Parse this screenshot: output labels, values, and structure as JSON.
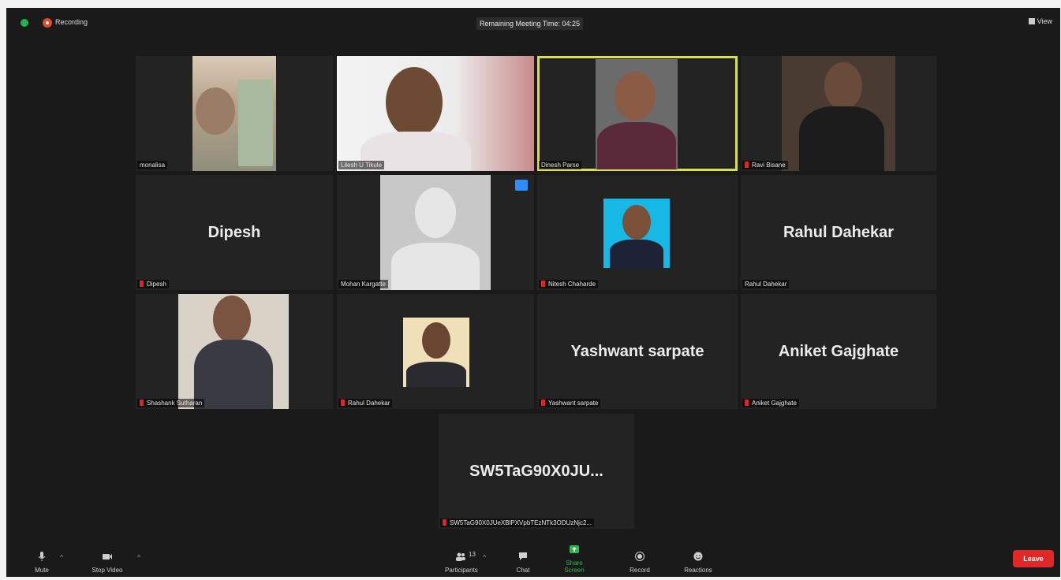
{
  "topbar": {
    "recording_label": "Recording",
    "remaining_time": "Remaining Meeting Time: 04:25",
    "view_label": "View"
  },
  "tiles": [
    {
      "name": "monalisa"
    },
    {
      "name": "Lilesh U Tikule"
    },
    {
      "name": "Dinesh Parse"
    },
    {
      "name": "Ravi Bisane"
    },
    {
      "name": "Dipesh",
      "display": "Dipesh"
    },
    {
      "name": "Mohan Kargatte"
    },
    {
      "name": "Nitesh Chaharde"
    },
    {
      "name": "Rahul Dahekar",
      "display": "Rahul Dahekar"
    },
    {
      "name": "Shashank Sutharan"
    },
    {
      "name": "Rahul Dahekar"
    },
    {
      "name": "Yashwant sarpate",
      "display": "Yashwant sarpate"
    },
    {
      "name": "Aniket Gajghate",
      "display": "Aniket Gajghate"
    },
    {
      "name": "SW5TaG90X0JUeXBlPXVpbTEzNTk3ODUzNjc2...",
      "display": "SW5TaG90X0JU..."
    }
  ],
  "toolbar": {
    "mute": "Mute",
    "stop_video": "Stop Video",
    "participants": "Participants",
    "participants_count": "13",
    "chat": "Chat",
    "share_screen": "Share Screen",
    "record": "Record",
    "reactions": "Reactions",
    "leave": "Leave"
  },
  "colors": {
    "active_speaker_border": "#d8e04a",
    "share_screen_green": "#2db84d",
    "leave_red": "#e02828",
    "muted_red": "#e02424"
  }
}
